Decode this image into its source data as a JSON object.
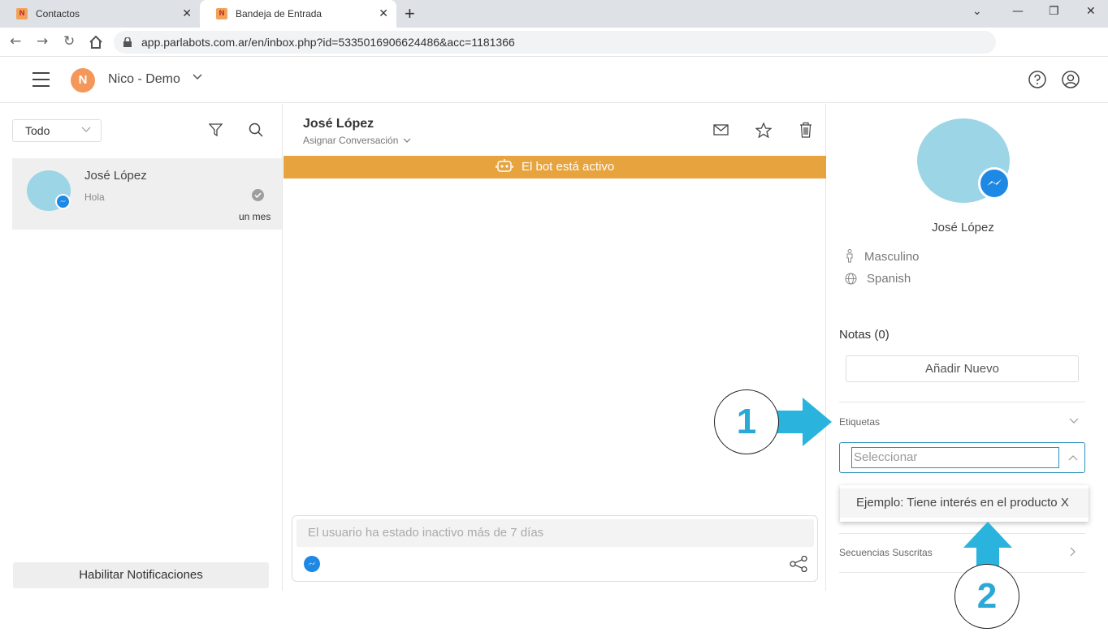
{
  "browser": {
    "tabs": [
      {
        "label": "Contactos",
        "favicon": "N"
      },
      {
        "label": "Bandeja de Entrada",
        "favicon": "N"
      }
    ],
    "url": "app.parlabots.com.ar/en/inbox.php?id=5335016906624486&acc=1181366"
  },
  "header": {
    "account_initial": "N",
    "account_name": "Nico - Demo"
  },
  "left": {
    "filter_value": "Todo",
    "conversation": {
      "name": "José López",
      "preview": "Hola",
      "time": "un mes"
    },
    "notifications_button": "Habilitar Notificaciones"
  },
  "chat": {
    "name": "José López",
    "assign_label": "Asignar Conversación",
    "bot_status": "El bot está activo",
    "composer_placeholder": "El usuario ha estado inactivo más de 7 días"
  },
  "profile": {
    "name": "José López",
    "gender": "Masculino",
    "language": "Spanish",
    "notes_title": "Notas (0)",
    "add_note_label": "Añadir Nuevo",
    "tags_title": "Etiquetas",
    "tags_placeholder": "Seleccionar",
    "tags_option": "Ejemplo: Tiene interés en el producto X",
    "sequences_title": "Secuencias Suscritas"
  },
  "annotations": [
    "1",
    "2"
  ],
  "colors": {
    "bot_bar": "#e7a33e",
    "arrow": "#29b3dd",
    "avatar": "#9bd5e6",
    "messenger": "#1e88e5"
  }
}
